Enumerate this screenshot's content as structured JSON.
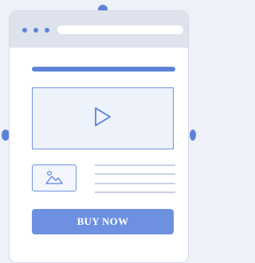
{
  "cta": {
    "label": "BUY NOW"
  },
  "icons": {
    "media": "play-icon",
    "thumbnail": "image-icon"
  },
  "colors": {
    "accent": "#5b83d8",
    "button": "#6d90e0",
    "titlebar": "#dde2ec",
    "background": "#eef1f7"
  }
}
